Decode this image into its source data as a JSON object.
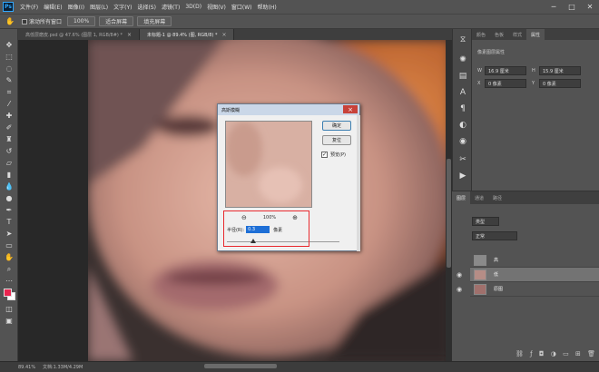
{
  "menubar": {
    "logo": "Ps",
    "items": [
      "文件(F)",
      "编辑(E)",
      "图像(I)",
      "图层(L)",
      "文字(Y)",
      "选择(S)",
      "滤镜(T)",
      "3D(D)",
      "视图(V)",
      "窗口(W)",
      "帮助(H)"
    ],
    "window_controls": [
      "─",
      "□",
      "✕"
    ]
  },
  "optbar": {
    "scroll_all_label": "滚动所有窗口",
    "zoom_btn": "100%",
    "fit_btn": "适合屏幕",
    "fill_btn": "填充屏幕"
  },
  "tabs": [
    {
      "label": "高低层磨皮.psd @ 47.6% (图层 1, RGB/8#) *",
      "active": false
    },
    {
      "label": "未标题-1 @ 89.4% (图, RGB/8) *",
      "active": true
    }
  ],
  "status": {
    "zoom": "89.41%",
    "doc": "文档:1.33M/4.29M"
  },
  "properties_panel": {
    "tabs": [
      "颜色",
      "色板",
      "样式",
      "属性"
    ],
    "active_tab": "属性",
    "title": "像素图层属性",
    "w_label": "W",
    "w_value": "16.9 厘米",
    "h_label": "H",
    "h_value": "15.9 厘米",
    "x_label": "X",
    "x_value": "0 像素",
    "y_label": "Y",
    "y_value": "0 像素"
  },
  "layers_panel": {
    "tabs": [
      "图层",
      "通道",
      "路径"
    ],
    "active_tab": "图层",
    "kind_filter": "类型",
    "blend_mode": "正常",
    "layers": [
      {
        "name": "高",
        "selected": false
      },
      {
        "name": "低",
        "selected": true
      },
      {
        "name": "原图",
        "selected": false
      }
    ]
  },
  "dialog": {
    "title": "高斯模糊",
    "ok": "确定",
    "reset": "复位",
    "preview_label": "预览(P)",
    "preview_checked": "✓",
    "zoom_out": "⊖",
    "zoom_level": "100%",
    "zoom_in": "⊕",
    "radius_label": "半径(R):",
    "radius_value": "0.3",
    "radius_unit": "像素"
  },
  "colors": {
    "fg": "#e8244e",
    "bg": "#ffffff",
    "accent": "#e8282d"
  }
}
